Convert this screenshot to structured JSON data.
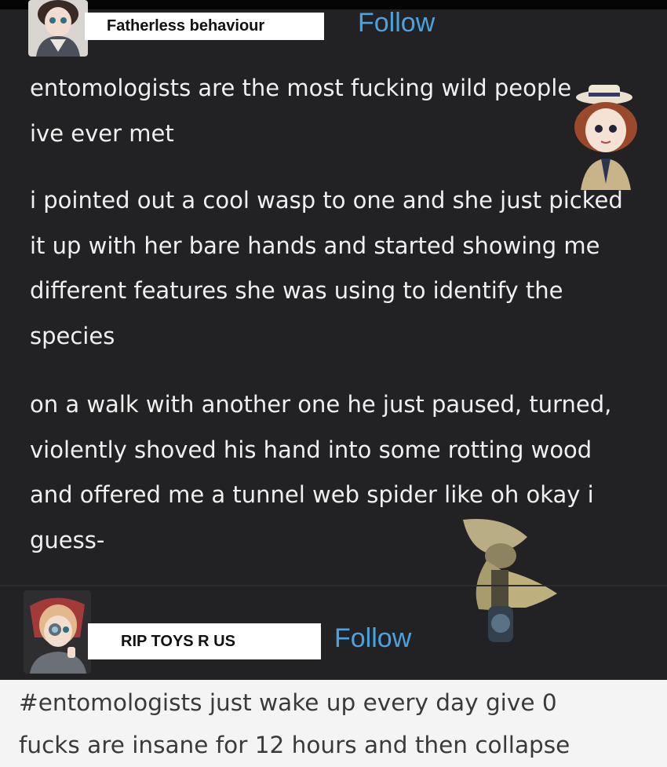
{
  "post": {
    "author": "Fatherless behaviour",
    "follow_label": "Follow",
    "paragraphs": [
      "entomologists are the most fucking wild people ive ever met",
      "i pointed out a cool wasp to one and she just picked it up with her bare hands and started showing me different features she was using to identify the species",
      "on a walk with another one he just paused, turned, violently shoved his hand into some rotting wood and offered me a tunnel web spider like oh okay i guess-"
    ]
  },
  "reblog": {
    "author": "RIP TOYS R US",
    "follow_label": "Follow",
    "tags": [
      "#entomologists just wake up every day give 0",
      "fucks are insane for 12 hours and then collapse"
    ]
  },
  "colors": {
    "background": "#222224",
    "follow": "#4aa3df",
    "tag_background": "#f4f4f4"
  },
  "icons": [
    "avatar-doll",
    "sticker-detective-girl",
    "sticker-scarecrow",
    "avatar-mechanic-girl"
  ]
}
